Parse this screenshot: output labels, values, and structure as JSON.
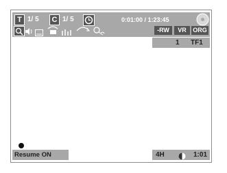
{
  "status": {
    "title_badge": "T",
    "title_counter": "1/ 5",
    "chapter_badge": "C",
    "chapter_counter": "1/ 5",
    "time": "0:01:00 / 1:23:45"
  },
  "icons": [
    "clock-icon",
    "disc-icon",
    "zoom-icon",
    "audio-icon",
    "subtitle-icon",
    "angle-icon",
    "marker-icon",
    "repeat-icon",
    "random-icon"
  ],
  "badges": {
    "rw": "-RW",
    "vr": "VR",
    "org": "ORG"
  },
  "channel": {
    "number": "1",
    "name": "TF1"
  },
  "bottom": {
    "resume": "Resume ON",
    "mode": "4H",
    "remaining": "1:01"
  },
  "colors": {
    "bar": "#a8a8a8",
    "badge_dark": "#555555",
    "text": "#ffffff"
  }
}
